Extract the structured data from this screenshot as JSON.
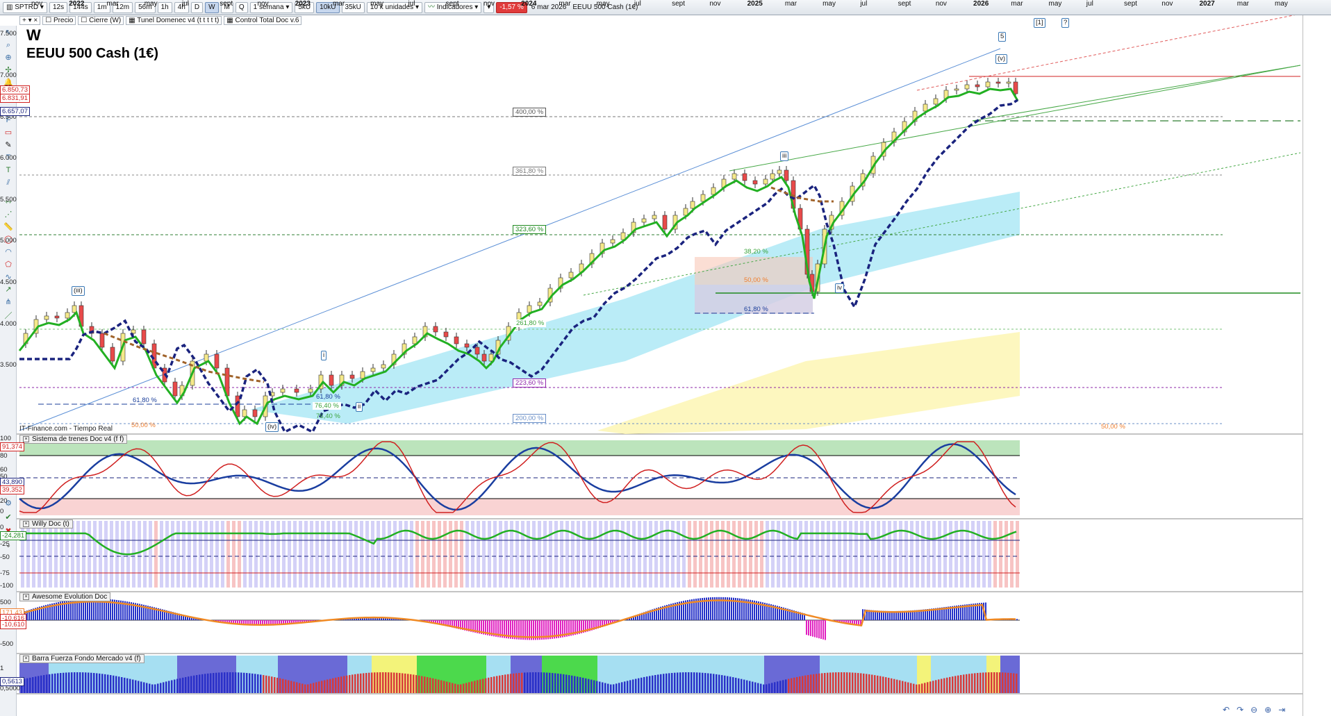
{
  "toolbar": {
    "symbol": "SPTRD",
    "timeframes": [
      "12s",
      "144s",
      "1m",
      "12m",
      "56m",
      "1h",
      "4h",
      "D",
      "W",
      "M",
      "Q"
    ],
    "active_timeframe": "W",
    "period": "1 semana",
    "units": [
      "5kU",
      "10kU",
      "35kU"
    ],
    "active_unit": "10kU",
    "units_select": "10 k unidades",
    "indicators_label": "Indicadores",
    "change_pct": "-1,57 %",
    "date": "6 mar 2026",
    "instrument": "EEUU 500 Cash (1€)"
  },
  "subbar": {
    "items": [
      "Precio",
      "Cierre (W)",
      "Tunel Domenec v4 (t t t t t)",
      "Control Total Doc v.6"
    ]
  },
  "chart": {
    "title_letter": "W",
    "title_name": "EEUU 500 Cash (1€)",
    "feed": "IT-Finance.com - Tiempo Real",
    "y_ticks": [
      "7.500",
      "7.000",
      "6.500",
      "6.000",
      "5.500",
      "5.000",
      "4.500",
      "4.000",
      "3.500"
    ],
    "price_labels": [
      {
        "text": "6.850,73",
        "color": "#d02020"
      },
      {
        "text": "6.831,91",
        "color": "#d02020"
      },
      {
        "text": "6.657,07",
        "color": "#1a237e"
      }
    ],
    "fibo_levels": [
      {
        "text": "400,00 %",
        "color": "#555555"
      },
      {
        "text": "361,80 %",
        "color": "#777777"
      },
      {
        "text": "323,60 %",
        "color": "#1f8a1f"
      },
      {
        "text": "261,80 %",
        "color": "#3aa33a"
      },
      {
        "text": "223,60 %",
        "color": "#8e24aa"
      },
      {
        "text": "200,00 %",
        "color": "#6a8fc7"
      },
      {
        "text": "38,20 %",
        "color": "#3aa33a"
      },
      {
        "text": "50,00 %",
        "color": "#ef7f2f"
      },
      {
        "text": "61,80 %",
        "color": "#1a3e9a"
      },
      {
        "text": "61,80 %",
        "color": "#1a3e9a"
      },
      {
        "text": "76,40 %",
        "color": "#3aa33a"
      },
      {
        "text": "50,00 %",
        "color": "#ef7f2f"
      },
      {
        "text": "61,80 %",
        "color": "#1a3e9a"
      },
      {
        "text": "76,40 %",
        "color": "#3aa33a"
      },
      {
        "text": "50,00 %",
        "color": "#ef7f2f"
      }
    ],
    "wave_labels": [
      "(iii)",
      "i",
      "ii",
      "(iv)",
      "iii",
      "iv",
      "(v)",
      "5",
      "[1]",
      "?"
    ],
    "x_ticks": [
      "nov",
      "2022",
      "mar",
      "may",
      "jul",
      "sept",
      "nov",
      "2023",
      "mar",
      "may",
      "jul",
      "sept",
      "nov",
      "2024",
      "mar",
      "may",
      "jul",
      "sept",
      "nov",
      "2025",
      "mar",
      "may",
      "jul",
      "sept",
      "nov",
      "2026",
      "mar",
      "may",
      "jul",
      "sept",
      "nov",
      "2027",
      "mar",
      "may"
    ]
  },
  "panels": [
    {
      "name": "Sistema de trenes Doc v4 (f f)",
      "ticks": [
        "100",
        "80",
        "60",
        "50",
        "20",
        "0"
      ],
      "values": [
        {
          "text": "91,374",
          "color": "#d02020"
        },
        {
          "text": "43,890",
          "color": "#1a237e"
        },
        {
          "text": "39,352",
          "color": "#d02020"
        }
      ]
    },
    {
      "name": "Willy Doc (t)",
      "ticks": [
        "0",
        "-25",
        "-50",
        "-75",
        "-100"
      ],
      "values": [
        {
          "text": "-24,281",
          "color": "#1f8a1f"
        }
      ]
    },
    {
      "name": "Awesome Evolution Doc",
      "ticks": [
        "500",
        "0",
        "-500"
      ],
      "values": [
        {
          "text": "171,43",
          "color": "#ef7f2f"
        },
        {
          "text": "-10,616",
          "color": "#d02020"
        },
        {
          "text": "-10,610",
          "color": "#d02020"
        }
      ]
    },
    {
      "name": "Barra Fuerza Fondo Mercado v4 (f)",
      "ticks": [
        "1",
        "0,5000"
      ],
      "values": [
        {
          "text": "0,5613",
          "color": "#1a237e"
        }
      ]
    }
  ],
  "colors": {
    "up": "#2e7d32",
    "down": "#c62828",
    "accent": "#1a237e",
    "bg": "#ffffff"
  }
}
